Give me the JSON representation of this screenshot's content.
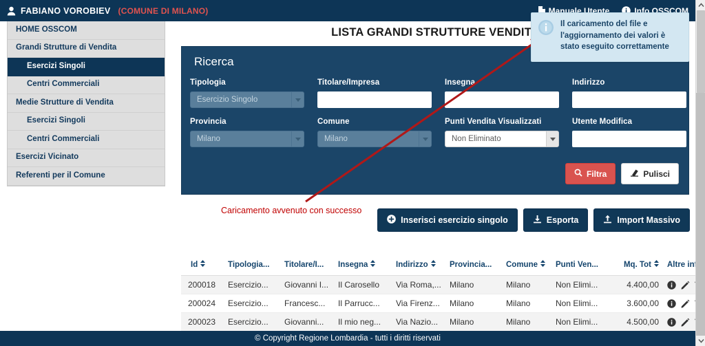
{
  "header": {
    "user_icon": "user-icon",
    "user_name": "FABIANO VOROBIEV",
    "user_comune": "(COMUNE DI MILANO)",
    "links": [
      {
        "icon": "document-icon",
        "label": "Manuale Utente"
      },
      {
        "icon": "info-circle-icon",
        "label": "Info OSSCOM"
      }
    ]
  },
  "sidebar": {
    "items": [
      {
        "label": "HOME OSSCOM",
        "level": 0,
        "active": false
      },
      {
        "label": "Grandi Strutture di Vendita",
        "level": 0,
        "active": false
      },
      {
        "label": "Esercizi Singoli",
        "level": 1,
        "active": true
      },
      {
        "label": "Centri Commerciali",
        "level": 1,
        "active": false
      },
      {
        "label": "Medie Strutture di Vendita",
        "level": 0,
        "active": false
      },
      {
        "label": "Esercizi Singoli",
        "level": 1,
        "active": false
      },
      {
        "label": "Centri Commerciali",
        "level": 1,
        "active": false
      },
      {
        "label": "Esercizi Vicinato",
        "level": 0,
        "active": false
      },
      {
        "label": "Referenti per il Comune",
        "level": 0,
        "active": false
      }
    ]
  },
  "main": {
    "page_title": "LISTA GRANDI STRUTTURE VENDITA"
  },
  "search_panel": {
    "title": "Ricerca",
    "fields": {
      "tipologia": {
        "label": "Tipologia",
        "value": "Esercizio Singolo",
        "type": "select",
        "disabled": true
      },
      "titolare": {
        "label": "Titolare/Impresa",
        "value": "",
        "placeholder": "",
        "type": "text"
      },
      "insegna": {
        "label": "Insegna",
        "value": "",
        "placeholder": "",
        "type": "text"
      },
      "indirizzo": {
        "label": "Indirizzo",
        "value": "",
        "placeholder": "",
        "type": "text"
      },
      "provincia": {
        "label": "Provincia",
        "value": "Milano",
        "type": "select",
        "disabled": true
      },
      "comune": {
        "label": "Comune",
        "value": "Milano",
        "type": "select",
        "disabled": true
      },
      "punti_vendita": {
        "label": "Punti Vendita Visualizzati",
        "value": "Non Eliminato",
        "type": "select",
        "disabled": false
      },
      "utente_modifica": {
        "label": "Utente Modifica",
        "value": "",
        "placeholder": "",
        "type": "text"
      }
    },
    "buttons": {
      "filtra": {
        "label": "Filtra",
        "icon": "search-icon",
        "color": "#d9534f"
      },
      "pulisci": {
        "label": "Pulisci",
        "icon": "eraser-icon",
        "color": "#ffffff"
      }
    }
  },
  "annotation": {
    "text": "Caricamento avvenuto con successo",
    "color": "#c00000"
  },
  "toast": {
    "icon": "info-circle-icon",
    "message": "Il caricamento del file e l'aggiornamento dei valori è stato eseguito correttamente",
    "background": "#d3e7f2"
  },
  "actions": [
    {
      "label": "Inserisci esercizio singolo",
      "icon": "plus-circle-icon"
    },
    {
      "label": "Esporta",
      "icon": "download-icon"
    },
    {
      "label": "Import Massivo",
      "icon": "upload-icon"
    }
  ],
  "table": {
    "columns": [
      {
        "label": "Id",
        "sortable": true,
        "key": "id"
      },
      {
        "label": "Tipologia...",
        "sortable": false,
        "key": "tipologia"
      },
      {
        "label": "Titolare/I...",
        "sortable": false,
        "key": "titolare"
      },
      {
        "label": "Insegna",
        "sortable": true,
        "key": "insegna"
      },
      {
        "label": "Indirizzo",
        "sortable": true,
        "key": "indirizzo"
      },
      {
        "label": "Provincia...",
        "sortable": false,
        "key": "provincia"
      },
      {
        "label": "Comune",
        "sortable": true,
        "key": "comune"
      },
      {
        "label": "Punti Ven...",
        "sortable": false,
        "key": "punti"
      },
      {
        "label": "Mq. Tot",
        "sortable": true,
        "key": "mq"
      },
      {
        "label": "Altre info",
        "sortable": false,
        "key": "altre"
      }
    ],
    "rows": [
      {
        "id": "200018",
        "tipologia": "Esercizio...",
        "titolare": "Giovanni I...",
        "insegna": "Il Carosello",
        "indirizzo": "Via Roma,...",
        "provincia": "Milano",
        "comune": "Milano",
        "punti": "Non Elimi...",
        "mq": "4.400,00"
      },
      {
        "id": "200024",
        "tipologia": "Esercizio...",
        "titolare": "Francesc...",
        "insegna": "Il Parrucc...",
        "indirizzo": "Via Firenz...",
        "provincia": "Milano",
        "comune": "Milano",
        "punti": "Non Elimi...",
        "mq": "3.600,00"
      },
      {
        "id": "200023",
        "tipologia": "Esercizio...",
        "titolare": "Giovanni...",
        "insegna": "Il mio neg...",
        "indirizzo": "Via Nazio...",
        "provincia": "Milano",
        "comune": "Milano",
        "punti": "Non Elimi...",
        "mq": "4.500,00"
      }
    ],
    "row_actions": [
      {
        "icon": "info-icon",
        "label": "Info"
      },
      {
        "icon": "pencil-icon",
        "label": "Modifica"
      },
      {
        "icon": "trash-icon",
        "label": "Elimina"
      }
    ]
  },
  "footer": {
    "text": "© Copyright Regione Lombardia - tutti i diritti riservati"
  }
}
